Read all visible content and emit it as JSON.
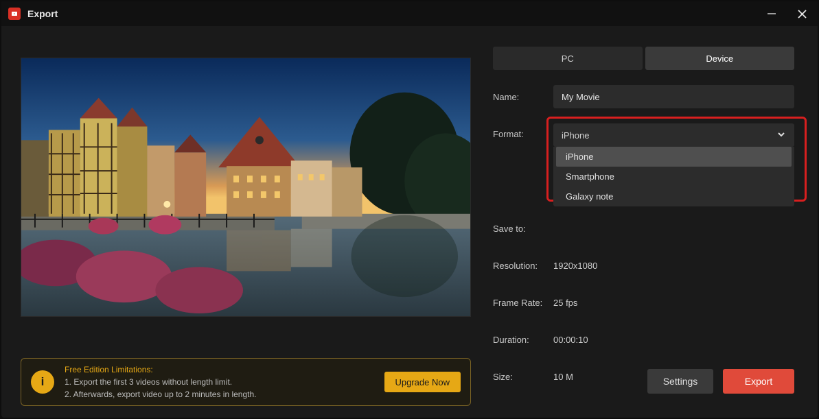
{
  "title": "Export",
  "tabs": {
    "pc": "PC",
    "device": "Device",
    "active": "device"
  },
  "name_label": "Name:",
  "name_value": "My Movie",
  "format_label": "Format:",
  "format_selected": "iPhone",
  "format_options": [
    "iPhone",
    "Smartphone",
    "Galaxy note"
  ],
  "saveto_label": "Save to:",
  "resolution": {
    "label": "Resolution:",
    "value": "1920x1080"
  },
  "framerate": {
    "label": "Frame Rate:",
    "value": "25 fps"
  },
  "duration": {
    "label": "Duration:",
    "value": "00:00:10"
  },
  "size": {
    "label": "Size:",
    "value": "10 M"
  },
  "limitations": {
    "title": "Free Edition Limitations:",
    "line1": "1. Export the first 3 videos without length limit.",
    "line2": "2. Afterwards, export video up to 2 minutes in length.",
    "upgrade": "Upgrade Now"
  },
  "buttons": {
    "settings": "Settings",
    "export": "Export"
  }
}
